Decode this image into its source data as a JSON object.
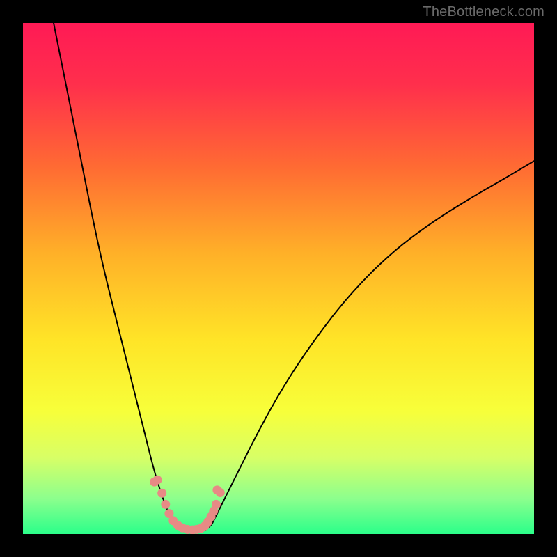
{
  "watermark": "TheBottleneck.com",
  "chart_data": {
    "type": "line",
    "title": "",
    "xlabel": "",
    "ylabel": "",
    "xlim": [
      0,
      100
    ],
    "ylim": [
      0,
      100
    ],
    "gradient_stops": [
      {
        "offset": 0.0,
        "color": "#ff1a55"
      },
      {
        "offset": 0.12,
        "color": "#ff2f4c"
      },
      {
        "offset": 0.28,
        "color": "#ff6a33"
      },
      {
        "offset": 0.45,
        "color": "#ffb028"
      },
      {
        "offset": 0.62,
        "color": "#ffe427"
      },
      {
        "offset": 0.76,
        "color": "#f7ff3a"
      },
      {
        "offset": 0.85,
        "color": "#d8ff66"
      },
      {
        "offset": 0.93,
        "color": "#8dff8d"
      },
      {
        "offset": 1.0,
        "color": "#2bff8a"
      }
    ],
    "series": [
      {
        "name": "left-branch",
        "x": [
          6,
          8,
          10,
          12,
          14,
          16,
          18,
          20,
          22,
          24,
          25.5,
          27,
          28.5,
          30
        ],
        "y": [
          100,
          90,
          80,
          70,
          60,
          51,
          43,
          35,
          27,
          19,
          13,
          8,
          4,
          1.5
        ]
      },
      {
        "name": "right-branch",
        "x": [
          37,
          39,
          42,
          46,
          51,
          57,
          64,
          72,
          80,
          88,
          95,
          100
        ],
        "y": [
          2,
          6,
          12,
          20,
          29,
          38,
          47,
          55,
          61,
          66,
          70,
          73
        ]
      },
      {
        "name": "flat-segment",
        "x": [
          30,
          31,
          32,
          33,
          34,
          35,
          36,
          37
        ],
        "y": [
          1.5,
          0.9,
          0.6,
          0.5,
          0.5,
          0.6,
          0.9,
          2
        ]
      }
    ],
    "markers": {
      "name": "artifact-dots",
      "color": "#e78a85",
      "points": [
        {
          "x": 25.7,
          "y": 10.2
        },
        {
          "x": 26.3,
          "y": 10.6
        },
        {
          "x": 27.2,
          "y": 8.0
        },
        {
          "x": 27.9,
          "y": 5.8
        },
        {
          "x": 28.6,
          "y": 4.0
        },
        {
          "x": 29.4,
          "y": 2.6
        },
        {
          "x": 30.3,
          "y": 1.7
        },
        {
          "x": 31.2,
          "y": 1.2
        },
        {
          "x": 32.2,
          "y": 0.9
        },
        {
          "x": 33.2,
          "y": 0.8
        },
        {
          "x": 34.0,
          "y": 0.9
        },
        {
          "x": 34.8,
          "y": 1.1
        },
        {
          "x": 35.6,
          "y": 1.6
        },
        {
          "x": 36.2,
          "y": 2.4
        },
        {
          "x": 36.8,
          "y": 3.4
        },
        {
          "x": 37.3,
          "y": 4.5
        },
        {
          "x": 37.8,
          "y": 5.8
        },
        {
          "x": 38.6,
          "y": 8.1
        },
        {
          "x": 38.0,
          "y": 8.6
        }
      ]
    }
  }
}
